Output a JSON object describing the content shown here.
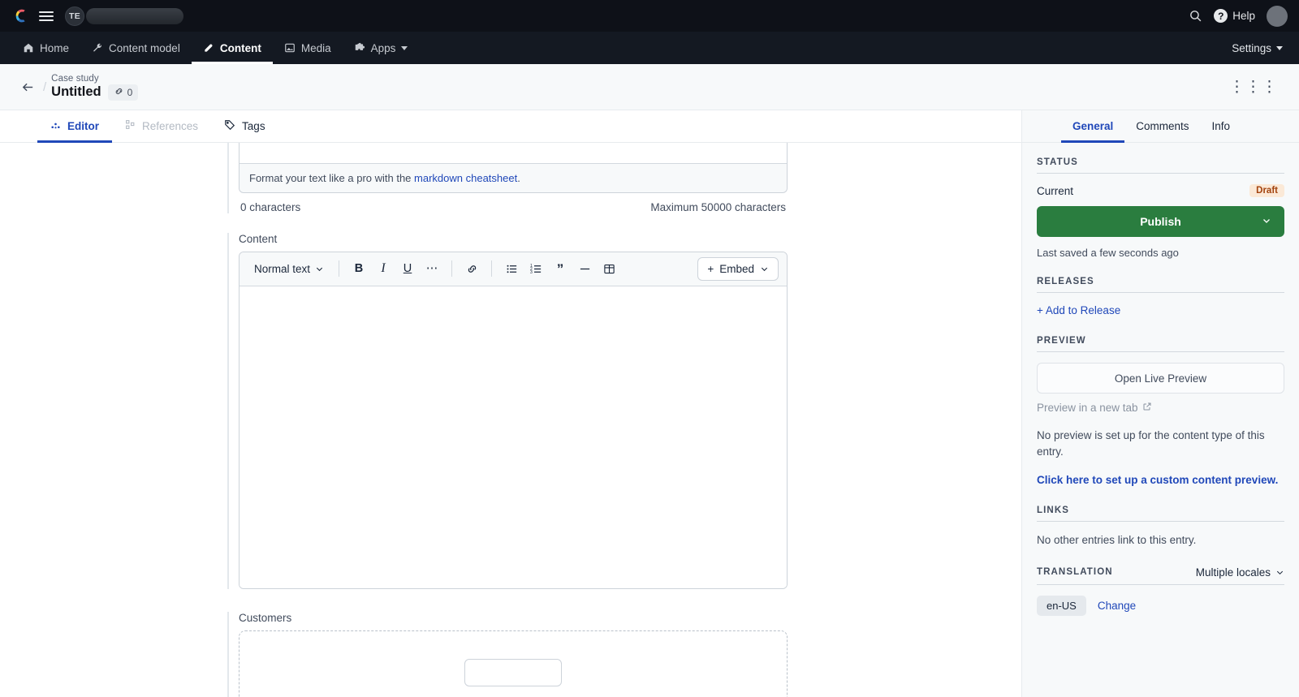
{
  "topbar": {
    "logo": "contentful-logo",
    "menu_icon": "hamburger-icon",
    "org_initials": "TE",
    "search_icon": "search-icon",
    "help_label": "Help",
    "help_icon": "question-circle-icon",
    "avatar": "user-avatar"
  },
  "nav": {
    "items": [
      {
        "label": "Home",
        "icon": "home-icon",
        "active": false
      },
      {
        "label": "Content model",
        "icon": "wrench-icon",
        "active": false
      },
      {
        "label": "Content",
        "icon": "content-icon",
        "active": true
      },
      {
        "label": "Media",
        "icon": "image-icon",
        "active": false
      },
      {
        "label": "Apps",
        "icon": "puzzle-icon",
        "active": false
      }
    ],
    "settings_label": "Settings"
  },
  "entry_header": {
    "content_type": "Case study",
    "title": "Untitled",
    "links_count": "0",
    "link_icon": "chain-link-icon",
    "back_icon": "arrow-left-icon",
    "more_icon": "ellipsis-icon"
  },
  "tabs": [
    {
      "label": "Editor",
      "icon": "editor-icon",
      "active": true,
      "disabled": false
    },
    {
      "label": "References",
      "icon": "references-icon",
      "active": false,
      "disabled": true
    },
    {
      "label": "Tags",
      "icon": "tag-icon",
      "active": false,
      "disabled": false
    }
  ],
  "fields": {
    "markdown": {
      "help_prefix": "Format your text like a pro with the ",
      "help_link": "markdown cheatsheet",
      "help_suffix": ".",
      "char_count": "0 characters",
      "max_chars": "Maximum 50000 characters"
    },
    "content": {
      "label": "Content",
      "toolbar": {
        "style_select": "Normal text",
        "buttons": [
          {
            "name": "bold-button",
            "glyph": "B"
          },
          {
            "name": "italic-button",
            "glyph": "I"
          },
          {
            "name": "underline-button",
            "glyph": "U"
          },
          {
            "name": "more-formats-button",
            "glyph": "…"
          },
          {
            "name": "link-button",
            "glyph": "link"
          },
          {
            "name": "unordered-list-button",
            "glyph": "ul"
          },
          {
            "name": "ordered-list-button",
            "glyph": "ol"
          },
          {
            "name": "quote-button",
            "glyph": "”"
          },
          {
            "name": "horizontal-rule-button",
            "glyph": "—"
          },
          {
            "name": "table-button",
            "glyph": "table"
          }
        ],
        "embed_label": "Embed"
      },
      "value": ""
    },
    "customers": {
      "label": "Customers"
    }
  },
  "sidebar": {
    "tabs": [
      {
        "label": "General",
        "active": true
      },
      {
        "label": "Comments",
        "active": false
      },
      {
        "label": "Info",
        "active": false
      }
    ],
    "status": {
      "heading": "STATUS",
      "current_label": "Current",
      "current_value": "Draft",
      "publish_label": "Publish",
      "last_saved": "Last saved a few seconds ago"
    },
    "releases": {
      "heading": "RELEASES",
      "add_label": "+ Add to Release"
    },
    "preview": {
      "heading": "PREVIEW",
      "open_live_label": "Open Live Preview",
      "new_tab_label": "Preview in a new tab",
      "external_icon": "external-link-icon",
      "no_preview_text": "No preview is set up for the content type of this entry.",
      "setup_link": "Click here to set up a custom content preview."
    },
    "links": {
      "heading": "LINKS",
      "empty_text": "No other entries link to this entry."
    },
    "translation": {
      "heading": "TRANSLATION",
      "locales_select": "Multiple locales",
      "active_locale": "en-US",
      "change_label": "Change"
    }
  },
  "colors": {
    "accent": "#2048b9",
    "publish_green": "#2a7d3f",
    "draft_badge_bg": "#fbe9d7",
    "draft_badge_text": "#a3430e",
    "topbar_bg": "#0e1118",
    "navbar_bg": "#141922",
    "sidebar_bg": "#f7f9fa"
  }
}
